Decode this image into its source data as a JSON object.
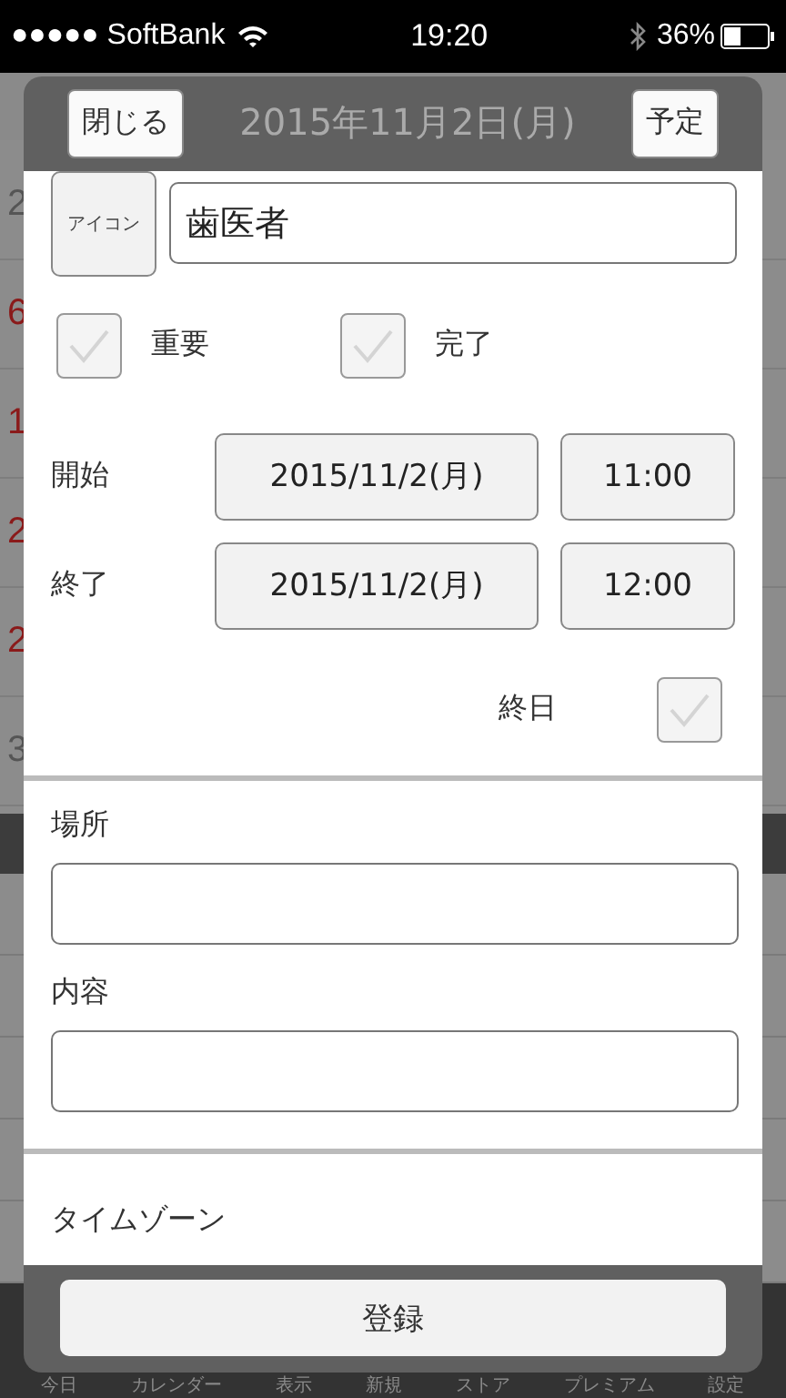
{
  "status_bar": {
    "carrier": "●●●●● SoftBank",
    "time": "19:20",
    "battery": "36%"
  },
  "background": {
    "day_numbers": [
      {
        "text": "2",
        "kind": "weekday"
      },
      {
        "text": "6",
        "kind": "holiday"
      },
      {
        "text": "1",
        "kind": "holiday"
      },
      {
        "text": "2",
        "kind": "holiday"
      },
      {
        "text": "2",
        "kind": "holiday"
      },
      {
        "text": "3",
        "kind": "weekday"
      }
    ],
    "tab_bar": [
      "今日",
      "カレンダー",
      "表示",
      "新規",
      "ストア",
      "プレミアム",
      "設定"
    ]
  },
  "dialog": {
    "close_button": "閉じる",
    "title": "2015年11月2日(月)",
    "type_button": "予定",
    "icon_button": "アイコン",
    "title_field": {
      "value": "歯医者"
    },
    "flags": [
      {
        "label": "重要",
        "checked": false
      },
      {
        "label": "完了",
        "checked": false
      }
    ],
    "start": {
      "label": "開始",
      "date": "2015/11/2(月)",
      "time": "11:00"
    },
    "end": {
      "label": "終了",
      "date": "2015/11/2(月)",
      "time": "12:00"
    },
    "all_day": {
      "label": "終日",
      "checked": false
    },
    "location": {
      "label": "場所"
    },
    "notes": {
      "label": "内容"
    },
    "timezone": {
      "label": "タイムゾーン"
    },
    "save_button": "登録"
  }
}
